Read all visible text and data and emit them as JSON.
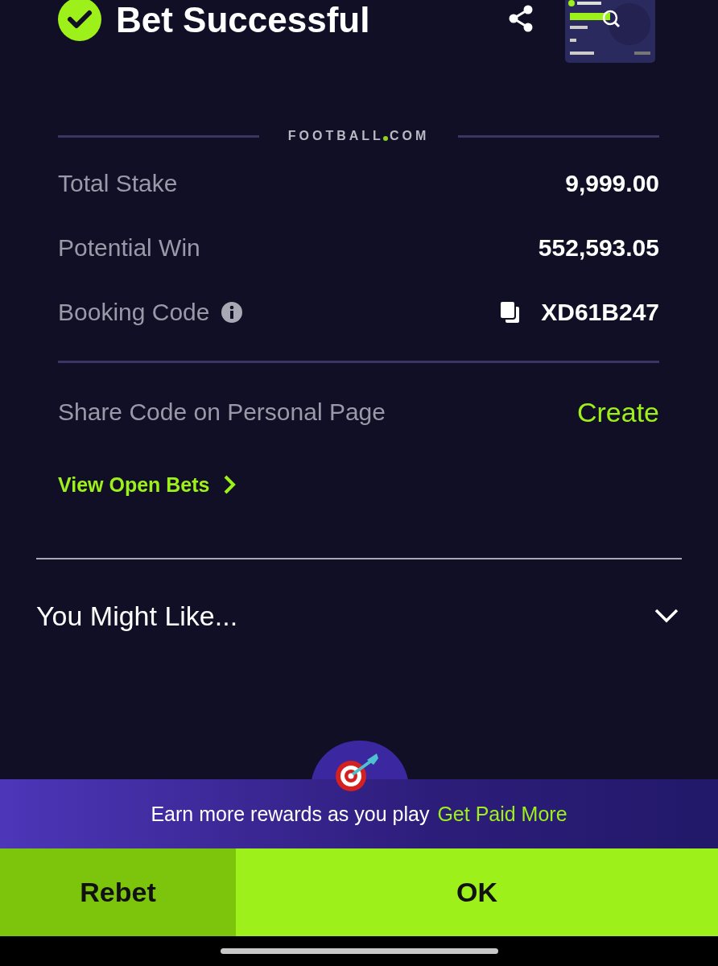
{
  "header": {
    "title": "Bet Successful",
    "success": true
  },
  "logo": {
    "left": "FOOTBALL",
    "right": "COM"
  },
  "summary": [
    {
      "label": "Total Stake",
      "value": "9,999.00",
      "kind": "plain"
    },
    {
      "label": "Potential Win",
      "value": "552,593.05",
      "kind": "plain"
    },
    {
      "label": "Booking Code",
      "value": "XD61B247",
      "kind": "code"
    }
  ],
  "share": {
    "label": "Share Code on Personal Page",
    "action": "Create"
  },
  "open_bets_link": "View Open Bets",
  "recommendations": {
    "title": "You Might Like...",
    "expanded": false
  },
  "rewards": {
    "text": "Earn more rewards as you play",
    "link": "Get Paid More"
  },
  "buttons": [
    {
      "label": "Rebet",
      "kind": "secondary"
    },
    {
      "label": "OK",
      "kind": "primary"
    }
  ]
}
